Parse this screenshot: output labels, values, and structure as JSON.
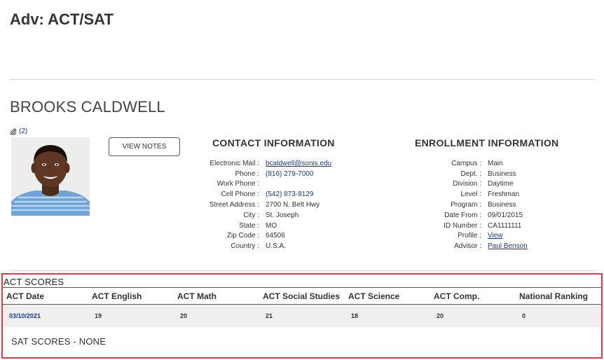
{
  "page": {
    "title": "Adv: ACT/SAT"
  },
  "student": {
    "name": "BROOKS CALDWELL",
    "attachment_count": "(2)",
    "view_notes_label": "VIEW NOTES"
  },
  "contact": {
    "heading": "CONTACT INFORMATION",
    "rows": [
      {
        "label": "Electronic Mail :",
        "value": "bcaldwell@sonis.edu"
      },
      {
        "label": "Phone :",
        "value": "(816) 279-7000"
      },
      {
        "label": "Work Phone :",
        "value": ""
      },
      {
        "label": "Cell Phone :",
        "value": "(542) 873-8129"
      },
      {
        "label": "Street Address :",
        "value": "2700 N. Belt Hwy"
      },
      {
        "label": "City :",
        "value": "St. Joseph"
      },
      {
        "label": "State :",
        "value": "MO"
      },
      {
        "label": "Zip Code :",
        "value": "64506"
      },
      {
        "label": "Country :",
        "value": "U.S.A."
      }
    ]
  },
  "enrollment": {
    "heading": "ENROLLMENT INFORMATION",
    "rows": [
      {
        "label": "Campus :",
        "value": "Main"
      },
      {
        "label": "Dept. :",
        "value": "Business"
      },
      {
        "label": "Division :",
        "value": "Daytime"
      },
      {
        "label": "Level :",
        "value": "Freshman"
      },
      {
        "label": "Program :",
        "value": "Business"
      },
      {
        "label": "Date From :",
        "value": "09/01/2015"
      },
      {
        "label": "ID Number :",
        "value": "CA1111111"
      },
      {
        "label": "Profile :",
        "value": "View"
      },
      {
        "label": "Advisor :",
        "value": "Paul Benson"
      }
    ]
  },
  "act": {
    "heading": "ACT SCORES",
    "columns": [
      "ACT Date",
      "ACT English",
      "ACT Math",
      "ACT Social Studies",
      "ACT Science",
      "ACT Comp.",
      "National Ranking"
    ],
    "rows": [
      [
        "03/10/2021",
        "19",
        "20",
        "21",
        "18",
        "20",
        "0"
      ]
    ]
  },
  "sat": {
    "heading": "SAT SCORES - NONE"
  },
  "colors": {
    "link": "#1a3a8c",
    "highlight_border": "#e0393e",
    "row_bg": "#efefef"
  }
}
